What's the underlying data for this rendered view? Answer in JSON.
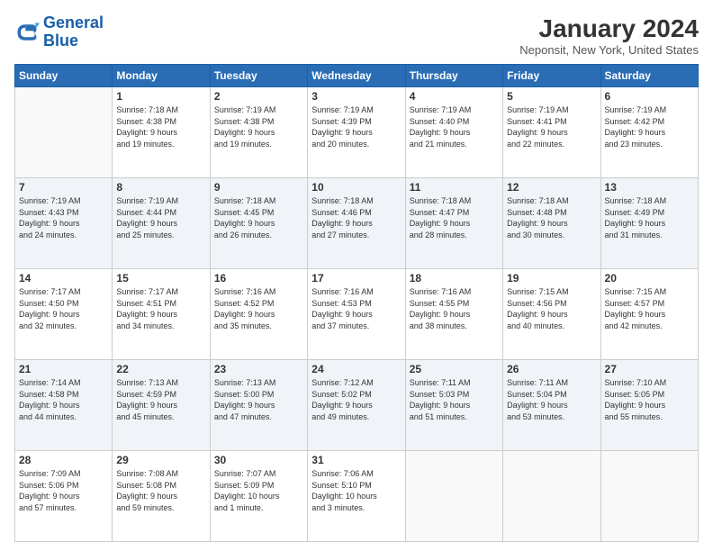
{
  "header": {
    "logo_line1": "General",
    "logo_line2": "Blue",
    "month_title": "January 2024",
    "location": "Neponsit, New York, United States"
  },
  "days_of_week": [
    "Sunday",
    "Monday",
    "Tuesday",
    "Wednesday",
    "Thursday",
    "Friday",
    "Saturday"
  ],
  "weeks": [
    [
      {
        "day": "",
        "info": ""
      },
      {
        "day": "1",
        "info": "Sunrise: 7:18 AM\nSunset: 4:38 PM\nDaylight: 9 hours\nand 19 minutes."
      },
      {
        "day": "2",
        "info": "Sunrise: 7:19 AM\nSunset: 4:38 PM\nDaylight: 9 hours\nand 19 minutes."
      },
      {
        "day": "3",
        "info": "Sunrise: 7:19 AM\nSunset: 4:39 PM\nDaylight: 9 hours\nand 20 minutes."
      },
      {
        "day": "4",
        "info": "Sunrise: 7:19 AM\nSunset: 4:40 PM\nDaylight: 9 hours\nand 21 minutes."
      },
      {
        "day": "5",
        "info": "Sunrise: 7:19 AM\nSunset: 4:41 PM\nDaylight: 9 hours\nand 22 minutes."
      },
      {
        "day": "6",
        "info": "Sunrise: 7:19 AM\nSunset: 4:42 PM\nDaylight: 9 hours\nand 23 minutes."
      }
    ],
    [
      {
        "day": "7",
        "info": "Sunrise: 7:19 AM\nSunset: 4:43 PM\nDaylight: 9 hours\nand 24 minutes."
      },
      {
        "day": "8",
        "info": "Sunrise: 7:19 AM\nSunset: 4:44 PM\nDaylight: 9 hours\nand 25 minutes."
      },
      {
        "day": "9",
        "info": "Sunrise: 7:18 AM\nSunset: 4:45 PM\nDaylight: 9 hours\nand 26 minutes."
      },
      {
        "day": "10",
        "info": "Sunrise: 7:18 AM\nSunset: 4:46 PM\nDaylight: 9 hours\nand 27 minutes."
      },
      {
        "day": "11",
        "info": "Sunrise: 7:18 AM\nSunset: 4:47 PM\nDaylight: 9 hours\nand 28 minutes."
      },
      {
        "day": "12",
        "info": "Sunrise: 7:18 AM\nSunset: 4:48 PM\nDaylight: 9 hours\nand 30 minutes."
      },
      {
        "day": "13",
        "info": "Sunrise: 7:18 AM\nSunset: 4:49 PM\nDaylight: 9 hours\nand 31 minutes."
      }
    ],
    [
      {
        "day": "14",
        "info": "Sunrise: 7:17 AM\nSunset: 4:50 PM\nDaylight: 9 hours\nand 32 minutes."
      },
      {
        "day": "15",
        "info": "Sunrise: 7:17 AM\nSunset: 4:51 PM\nDaylight: 9 hours\nand 34 minutes."
      },
      {
        "day": "16",
        "info": "Sunrise: 7:16 AM\nSunset: 4:52 PM\nDaylight: 9 hours\nand 35 minutes."
      },
      {
        "day": "17",
        "info": "Sunrise: 7:16 AM\nSunset: 4:53 PM\nDaylight: 9 hours\nand 37 minutes."
      },
      {
        "day": "18",
        "info": "Sunrise: 7:16 AM\nSunset: 4:55 PM\nDaylight: 9 hours\nand 38 minutes."
      },
      {
        "day": "19",
        "info": "Sunrise: 7:15 AM\nSunset: 4:56 PM\nDaylight: 9 hours\nand 40 minutes."
      },
      {
        "day": "20",
        "info": "Sunrise: 7:15 AM\nSunset: 4:57 PM\nDaylight: 9 hours\nand 42 minutes."
      }
    ],
    [
      {
        "day": "21",
        "info": "Sunrise: 7:14 AM\nSunset: 4:58 PM\nDaylight: 9 hours\nand 44 minutes."
      },
      {
        "day": "22",
        "info": "Sunrise: 7:13 AM\nSunset: 4:59 PM\nDaylight: 9 hours\nand 45 minutes."
      },
      {
        "day": "23",
        "info": "Sunrise: 7:13 AM\nSunset: 5:00 PM\nDaylight: 9 hours\nand 47 minutes."
      },
      {
        "day": "24",
        "info": "Sunrise: 7:12 AM\nSunset: 5:02 PM\nDaylight: 9 hours\nand 49 minutes."
      },
      {
        "day": "25",
        "info": "Sunrise: 7:11 AM\nSunset: 5:03 PM\nDaylight: 9 hours\nand 51 minutes."
      },
      {
        "day": "26",
        "info": "Sunrise: 7:11 AM\nSunset: 5:04 PM\nDaylight: 9 hours\nand 53 minutes."
      },
      {
        "day": "27",
        "info": "Sunrise: 7:10 AM\nSunset: 5:05 PM\nDaylight: 9 hours\nand 55 minutes."
      }
    ],
    [
      {
        "day": "28",
        "info": "Sunrise: 7:09 AM\nSunset: 5:06 PM\nDaylight: 9 hours\nand 57 minutes."
      },
      {
        "day": "29",
        "info": "Sunrise: 7:08 AM\nSunset: 5:08 PM\nDaylight: 9 hours\nand 59 minutes."
      },
      {
        "day": "30",
        "info": "Sunrise: 7:07 AM\nSunset: 5:09 PM\nDaylight: 10 hours\nand 1 minute."
      },
      {
        "day": "31",
        "info": "Sunrise: 7:06 AM\nSunset: 5:10 PM\nDaylight: 10 hours\nand 3 minutes."
      },
      {
        "day": "",
        "info": ""
      },
      {
        "day": "",
        "info": ""
      },
      {
        "day": "",
        "info": ""
      }
    ]
  ]
}
